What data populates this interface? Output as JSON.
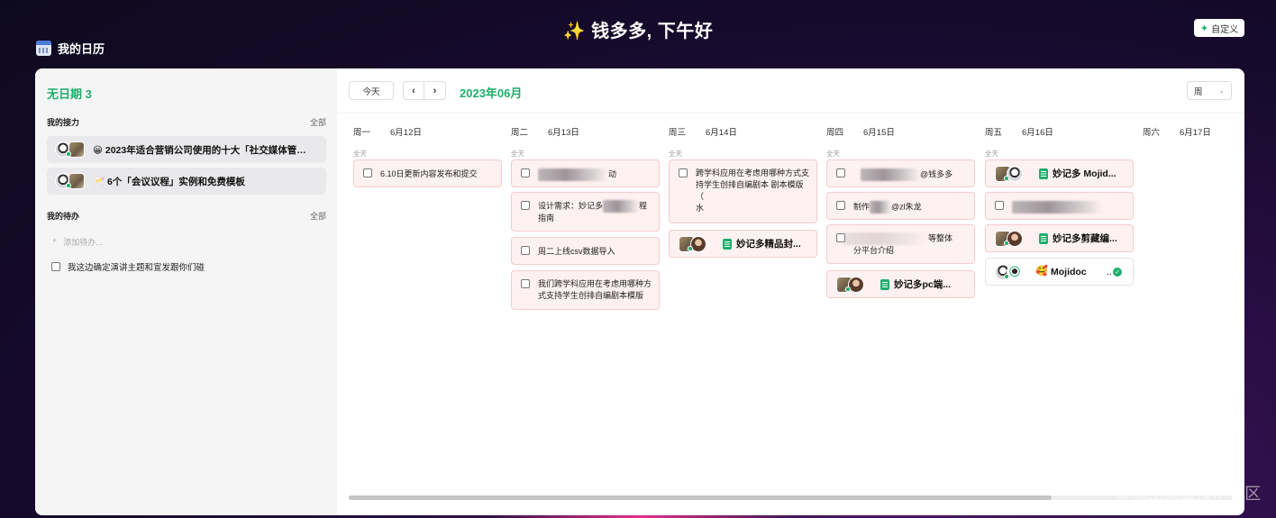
{
  "header": {
    "greeting_emoji": "✨",
    "greeting": "钱多多, 下午好",
    "customize_label": "自定义",
    "app_title": "我的日历"
  },
  "sidebar": {
    "undated_title": "无日期 3",
    "relay": {
      "label": "我的接力",
      "all": "全部",
      "items": [
        {
          "emoji": "😀",
          "text": "2023年适合营销公司使用的十大「社交媒体管理..."
        },
        {
          "emoji": "🥂",
          "text": "6个「会议议程」实例和免费模板"
        }
      ]
    },
    "todos": {
      "label": "我的待办",
      "all": "全部",
      "add_placeholder": "添加待办...",
      "add_icon": "+",
      "items": [
        {
          "text": "我这边确定演讲主题和宣发跟你们碰",
          "checked": false
        }
      ]
    }
  },
  "toolbar": {
    "today": "今天",
    "prev": "‹",
    "next": "›",
    "month": "2023年06月",
    "view": "周"
  },
  "week": {
    "allday_label": "全天",
    "days": [
      {
        "weekday": "周一",
        "date": "6月12日"
      },
      {
        "weekday": "周二",
        "date": "6月13日"
      },
      {
        "weekday": "周三",
        "date": "6月14日"
      },
      {
        "weekday": "周四",
        "date": "6月15日"
      },
      {
        "weekday": "周五",
        "date": "6月16日"
      },
      {
        "weekday": "周六",
        "date": "6月17日"
      }
    ]
  },
  "events": {
    "mon": [
      "6.10日更新内容发布和提交"
    ],
    "tue": [
      "动",
      "设计需求：妙记多",
      "程指南",
      "周二上线csv数据导入",
      "我们跨学科应用在考虑用哪种方式支持学生创排自编剧本模版"
    ],
    "wed": {
      "task_line1": "跨学科应用在考虑用哪种方式支持学生创排自编剧本 剧本模版",
      "task_line2": "（",
      "task_line3": "水",
      "doc": "妙记多精品封..."
    },
    "thu": {
      "task1_suffix": "@钱多多",
      "task2_prefix": "制作",
      "task2_suffix": "@zl朱龙",
      "task3_suffix": "等整体",
      "task3_line2": "分平台介绍",
      "doc": "妙记多pc端..."
    },
    "fri": {
      "doc1": "妙记多 Mojid...",
      "doc2": "妙记多剪藏编...",
      "doc3_emoji": "🥰",
      "doc3": "Mojidoc",
      "doc3_suffix": "..",
      "check": "✓"
    }
  },
  "watermark": "@稀土掘金技术社区",
  "colors": {
    "accent": "#1fae6c",
    "card_bg": "#fef1f1",
    "card_border": "#f4cccc"
  }
}
